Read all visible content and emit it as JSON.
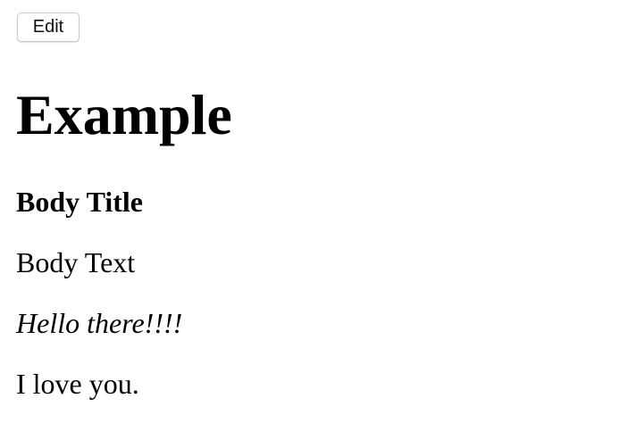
{
  "toolbar": {
    "edit_label": "Edit"
  },
  "document": {
    "title": "Example",
    "body_title": "Body Title",
    "body_text": "Body Text",
    "lines": [
      "Hello there!!!!",
      "I love you."
    ]
  }
}
